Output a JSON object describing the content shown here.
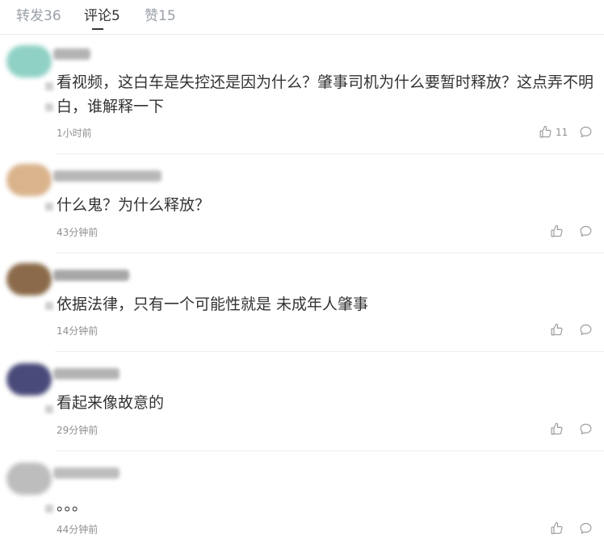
{
  "tabs": [
    {
      "label": "转发36",
      "active": false
    },
    {
      "label": "评论5",
      "active": true
    },
    {
      "label": "赞15",
      "active": false
    }
  ],
  "comments": [
    {
      "text": "看视频，这白车是失控还是因为什么？肇事司机为什么要暂时释放？这点弄不明白，谁解释一下",
      "time": "1小时前",
      "likes": "11",
      "avatar_color": "#8fd1c5"
    },
    {
      "text": "什么鬼？为什么释放？",
      "time": "43分钟前",
      "likes": "",
      "avatar_color": "#d9b38c"
    },
    {
      "text": "依据法律，只有一个可能性就是 未成年人肇事",
      "time": "14分钟前",
      "likes": "",
      "avatar_color": "#8a6a4a"
    },
    {
      "text": "看起来像故意的",
      "time": "29分钟前",
      "likes": "",
      "avatar_color": "#4a4a7a"
    },
    {
      "text": "。。。",
      "time": "44分钟前",
      "likes": "",
      "avatar_color": "#bdbdbd"
    }
  ],
  "colors": {
    "text": "#333333",
    "muted": "#8f8f8f",
    "tab_inactive": "#9aa0a8",
    "divider": "#eeeeee"
  },
  "icons": {
    "like": "thumbs-up-icon",
    "reply": "comment-bubble-icon"
  }
}
